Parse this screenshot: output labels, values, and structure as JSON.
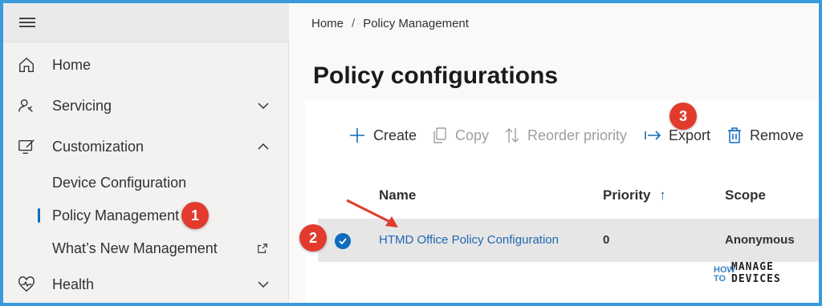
{
  "sidebar": {
    "items": [
      {
        "label": "Home"
      },
      {
        "label": "Servicing"
      },
      {
        "label": "Customization"
      },
      {
        "label": "Health"
      }
    ],
    "sub_items": [
      {
        "label": "Device Configuration"
      },
      {
        "label": "Policy Management"
      },
      {
        "label": "What’s New Management"
      }
    ]
  },
  "breadcrumb": {
    "home": "Home",
    "sep": "/",
    "current": "Policy Management"
  },
  "page": {
    "title": "Policy configurations"
  },
  "toolbar": {
    "create": "Create",
    "copy": "Copy",
    "reorder": "Reorder priority",
    "export": "Export",
    "remove": "Remove"
  },
  "table": {
    "headers": {
      "name": "Name",
      "priority": "Priority",
      "scope": "Scope"
    },
    "sort_arrow": "↑",
    "rows": [
      {
        "name": "HTMD Office Policy Configuration",
        "priority": "0",
        "scope": "Anonymous"
      }
    ]
  },
  "annotations": {
    "one": "1",
    "two": "2",
    "three": "3"
  },
  "logo": {
    "how": "HOW",
    "to": "TO",
    "line1": "MANAGE",
    "line2": "DEVICES"
  },
  "colors": {
    "accent": "#0f6cbd",
    "badge": "#e23b2e",
    "frame": "#3a9bdc",
    "link": "#1f67b1"
  }
}
